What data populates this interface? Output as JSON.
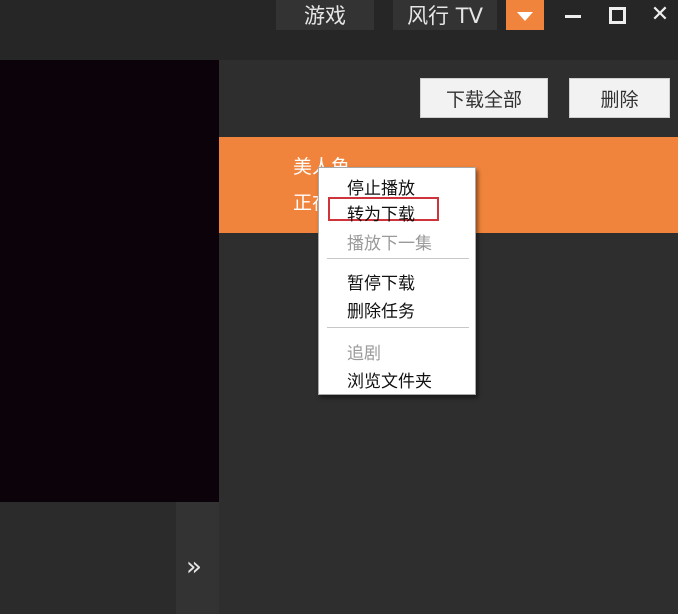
{
  "titlebar": {
    "tabs": [
      {
        "label": "游戏"
      },
      {
        "label": "风行 TV"
      }
    ],
    "menu_button_icon": "chevron-down-icon",
    "window_controls": [
      "minimize-icon",
      "maximize-icon",
      "close-icon"
    ],
    "close_glyph": "✕"
  },
  "toolbar": {
    "download_all_label": "下载全部",
    "delete_label": "删除"
  },
  "task": {
    "title": "美人鱼",
    "status": "正在播放"
  },
  "context_menu": {
    "groups": [
      [
        {
          "label": "停止播放",
          "enabled": true
        },
        {
          "label": "转为下载",
          "enabled": true,
          "highlighted": true
        },
        {
          "label": "播放下一集",
          "enabled": false
        }
      ],
      [
        {
          "label": "暂停下载",
          "enabled": true
        },
        {
          "label": "删除任务",
          "enabled": true
        }
      ],
      [
        {
          "label": "追剧",
          "enabled": false
        },
        {
          "label": "浏览文件夹",
          "enabled": true
        }
      ]
    ]
  },
  "sidebar": {
    "expand_glyph": "»"
  },
  "colors": {
    "accent": "#f0843c",
    "background": "#2b2b2b",
    "highlight": "#d0343b"
  }
}
